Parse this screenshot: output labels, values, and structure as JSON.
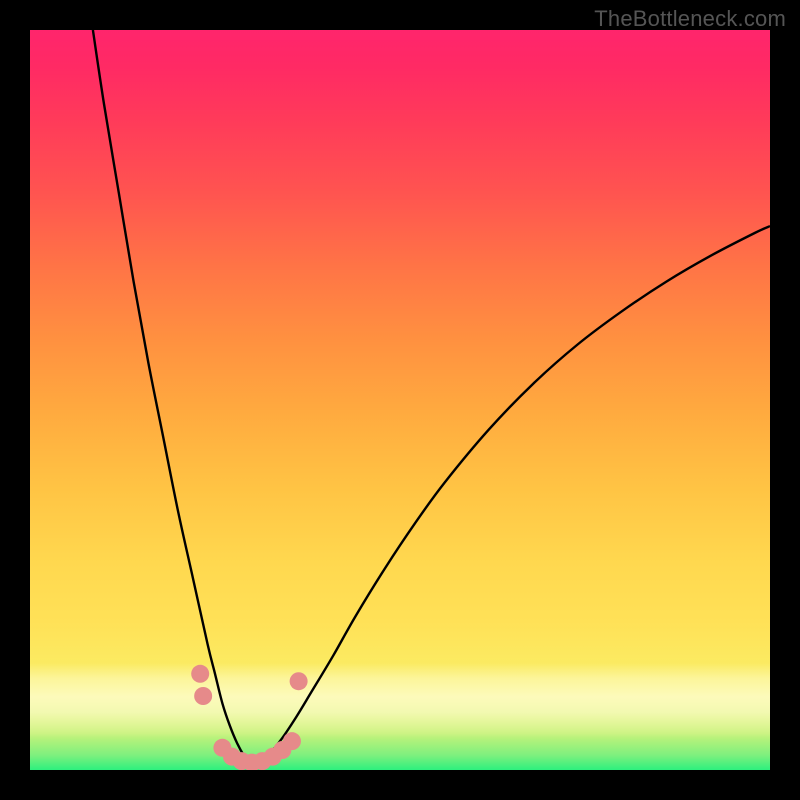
{
  "watermark": "TheBottleneck.com",
  "chart_data": {
    "type": "line",
    "title": "",
    "xlabel": "",
    "ylabel": "",
    "xlim": [
      0,
      100
    ],
    "ylim": [
      0,
      100
    ],
    "legend": false,
    "grid": false,
    "gradient_stops": [
      {
        "pos": 0,
        "color": "#2df07e"
      },
      {
        "pos": 5,
        "color": "#c8f27a"
      },
      {
        "pos": 10,
        "color": "#f8f26a"
      },
      {
        "pos": 28,
        "color": "#ffd84f"
      },
      {
        "pos": 48,
        "color": "#ffab3f"
      },
      {
        "pos": 68,
        "color": "#ff7446"
      },
      {
        "pos": 88,
        "color": "#ff3a5a"
      },
      {
        "pos": 100,
        "color": "#ff256c"
      }
    ],
    "series": [
      {
        "name": "bottleneck-curve-left",
        "x": [
          8.5,
          10,
          12,
          14,
          16,
          18,
          20,
          22,
          24,
          25,
          26,
          27,
          28,
          29,
          30
        ],
        "y": [
          100,
          90,
          78,
          66,
          55,
          45,
          35,
          26,
          17,
          13,
          9,
          6,
          3.6,
          1.8,
          0.5
        ]
      },
      {
        "name": "bottleneck-curve-right",
        "x": [
          30,
          32,
          34,
          36,
          38,
          41,
          44,
          48,
          52,
          56,
          62,
          68,
          74,
          80,
          86,
          92,
          98,
          100
        ],
        "y": [
          0.5,
          1.8,
          4.2,
          7.2,
          10.5,
          15.5,
          20.8,
          27.3,
          33.3,
          38.8,
          46,
          52.2,
          57.5,
          62,
          66,
          69.5,
          72.6,
          73.5
        ]
      }
    ],
    "markers": {
      "name": "highlight-dots",
      "color": "#e68a8a",
      "radius": 9,
      "points": [
        {
          "x": 23.0,
          "y": 13.0
        },
        {
          "x": 23.4,
          "y": 10.0
        },
        {
          "x": 26.0,
          "y": 3.0
        },
        {
          "x": 27.3,
          "y": 1.8
        },
        {
          "x": 28.6,
          "y": 1.2
        },
        {
          "x": 30.0,
          "y": 1.0
        },
        {
          "x": 31.4,
          "y": 1.2
        },
        {
          "x": 32.8,
          "y": 1.8
        },
        {
          "x": 34.1,
          "y": 2.7
        },
        {
          "x": 35.4,
          "y": 3.9
        },
        {
          "x": 36.3,
          "y": 12.0
        }
      ]
    },
    "trough_x": 30
  }
}
